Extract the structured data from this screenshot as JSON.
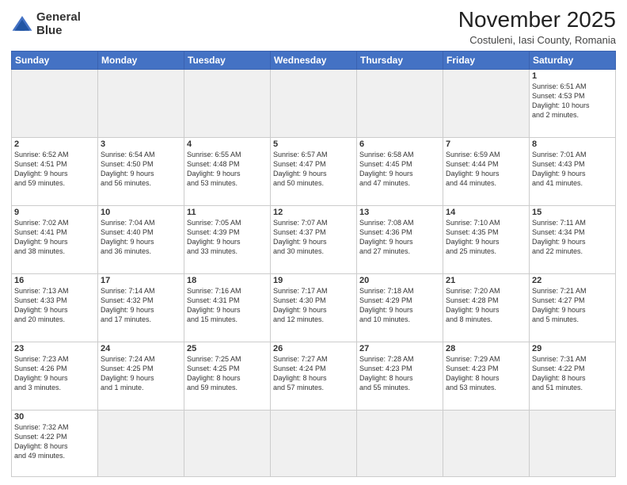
{
  "logo": {
    "line1": "General",
    "line2": "Blue"
  },
  "title": "November 2025",
  "subtitle": "Costuleni, Iasi County, Romania",
  "header_days": [
    "Sunday",
    "Monday",
    "Tuesday",
    "Wednesday",
    "Thursday",
    "Friday",
    "Saturday"
  ],
  "weeks": [
    [
      {
        "day": "",
        "info": ""
      },
      {
        "day": "",
        "info": ""
      },
      {
        "day": "",
        "info": ""
      },
      {
        "day": "",
        "info": ""
      },
      {
        "day": "",
        "info": ""
      },
      {
        "day": "",
        "info": ""
      },
      {
        "day": "1",
        "info": "Sunrise: 6:51 AM\nSunset: 4:53 PM\nDaylight: 10 hours\nand 2 minutes."
      }
    ],
    [
      {
        "day": "2",
        "info": "Sunrise: 6:52 AM\nSunset: 4:51 PM\nDaylight: 9 hours\nand 59 minutes."
      },
      {
        "day": "3",
        "info": "Sunrise: 6:54 AM\nSunset: 4:50 PM\nDaylight: 9 hours\nand 56 minutes."
      },
      {
        "day": "4",
        "info": "Sunrise: 6:55 AM\nSunset: 4:48 PM\nDaylight: 9 hours\nand 53 minutes."
      },
      {
        "day": "5",
        "info": "Sunrise: 6:57 AM\nSunset: 4:47 PM\nDaylight: 9 hours\nand 50 minutes."
      },
      {
        "day": "6",
        "info": "Sunrise: 6:58 AM\nSunset: 4:45 PM\nDaylight: 9 hours\nand 47 minutes."
      },
      {
        "day": "7",
        "info": "Sunrise: 6:59 AM\nSunset: 4:44 PM\nDaylight: 9 hours\nand 44 minutes."
      },
      {
        "day": "8",
        "info": "Sunrise: 7:01 AM\nSunset: 4:43 PM\nDaylight: 9 hours\nand 41 minutes."
      }
    ],
    [
      {
        "day": "9",
        "info": "Sunrise: 7:02 AM\nSunset: 4:41 PM\nDaylight: 9 hours\nand 38 minutes."
      },
      {
        "day": "10",
        "info": "Sunrise: 7:04 AM\nSunset: 4:40 PM\nDaylight: 9 hours\nand 36 minutes."
      },
      {
        "day": "11",
        "info": "Sunrise: 7:05 AM\nSunset: 4:39 PM\nDaylight: 9 hours\nand 33 minutes."
      },
      {
        "day": "12",
        "info": "Sunrise: 7:07 AM\nSunset: 4:37 PM\nDaylight: 9 hours\nand 30 minutes."
      },
      {
        "day": "13",
        "info": "Sunrise: 7:08 AM\nSunset: 4:36 PM\nDaylight: 9 hours\nand 27 minutes."
      },
      {
        "day": "14",
        "info": "Sunrise: 7:10 AM\nSunset: 4:35 PM\nDaylight: 9 hours\nand 25 minutes."
      },
      {
        "day": "15",
        "info": "Sunrise: 7:11 AM\nSunset: 4:34 PM\nDaylight: 9 hours\nand 22 minutes."
      }
    ],
    [
      {
        "day": "16",
        "info": "Sunrise: 7:13 AM\nSunset: 4:33 PM\nDaylight: 9 hours\nand 20 minutes."
      },
      {
        "day": "17",
        "info": "Sunrise: 7:14 AM\nSunset: 4:32 PM\nDaylight: 9 hours\nand 17 minutes."
      },
      {
        "day": "18",
        "info": "Sunrise: 7:16 AM\nSunset: 4:31 PM\nDaylight: 9 hours\nand 15 minutes."
      },
      {
        "day": "19",
        "info": "Sunrise: 7:17 AM\nSunset: 4:30 PM\nDaylight: 9 hours\nand 12 minutes."
      },
      {
        "day": "20",
        "info": "Sunrise: 7:18 AM\nSunset: 4:29 PM\nDaylight: 9 hours\nand 10 minutes."
      },
      {
        "day": "21",
        "info": "Sunrise: 7:20 AM\nSunset: 4:28 PM\nDaylight: 9 hours\nand 8 minutes."
      },
      {
        "day": "22",
        "info": "Sunrise: 7:21 AM\nSunset: 4:27 PM\nDaylight: 9 hours\nand 5 minutes."
      }
    ],
    [
      {
        "day": "23",
        "info": "Sunrise: 7:23 AM\nSunset: 4:26 PM\nDaylight: 9 hours\nand 3 minutes."
      },
      {
        "day": "24",
        "info": "Sunrise: 7:24 AM\nSunset: 4:25 PM\nDaylight: 9 hours\nand 1 minute."
      },
      {
        "day": "25",
        "info": "Sunrise: 7:25 AM\nSunset: 4:25 PM\nDaylight: 8 hours\nand 59 minutes."
      },
      {
        "day": "26",
        "info": "Sunrise: 7:27 AM\nSunset: 4:24 PM\nDaylight: 8 hours\nand 57 minutes."
      },
      {
        "day": "27",
        "info": "Sunrise: 7:28 AM\nSunset: 4:23 PM\nDaylight: 8 hours\nand 55 minutes."
      },
      {
        "day": "28",
        "info": "Sunrise: 7:29 AM\nSunset: 4:23 PM\nDaylight: 8 hours\nand 53 minutes."
      },
      {
        "day": "29",
        "info": "Sunrise: 7:31 AM\nSunset: 4:22 PM\nDaylight: 8 hours\nand 51 minutes."
      }
    ],
    [
      {
        "day": "30",
        "info": "Sunrise: 7:32 AM\nSunset: 4:22 PM\nDaylight: 8 hours\nand 49 minutes."
      },
      {
        "day": "",
        "info": ""
      },
      {
        "day": "",
        "info": ""
      },
      {
        "day": "",
        "info": ""
      },
      {
        "day": "",
        "info": ""
      },
      {
        "day": "",
        "info": ""
      },
      {
        "day": "",
        "info": ""
      }
    ]
  ]
}
